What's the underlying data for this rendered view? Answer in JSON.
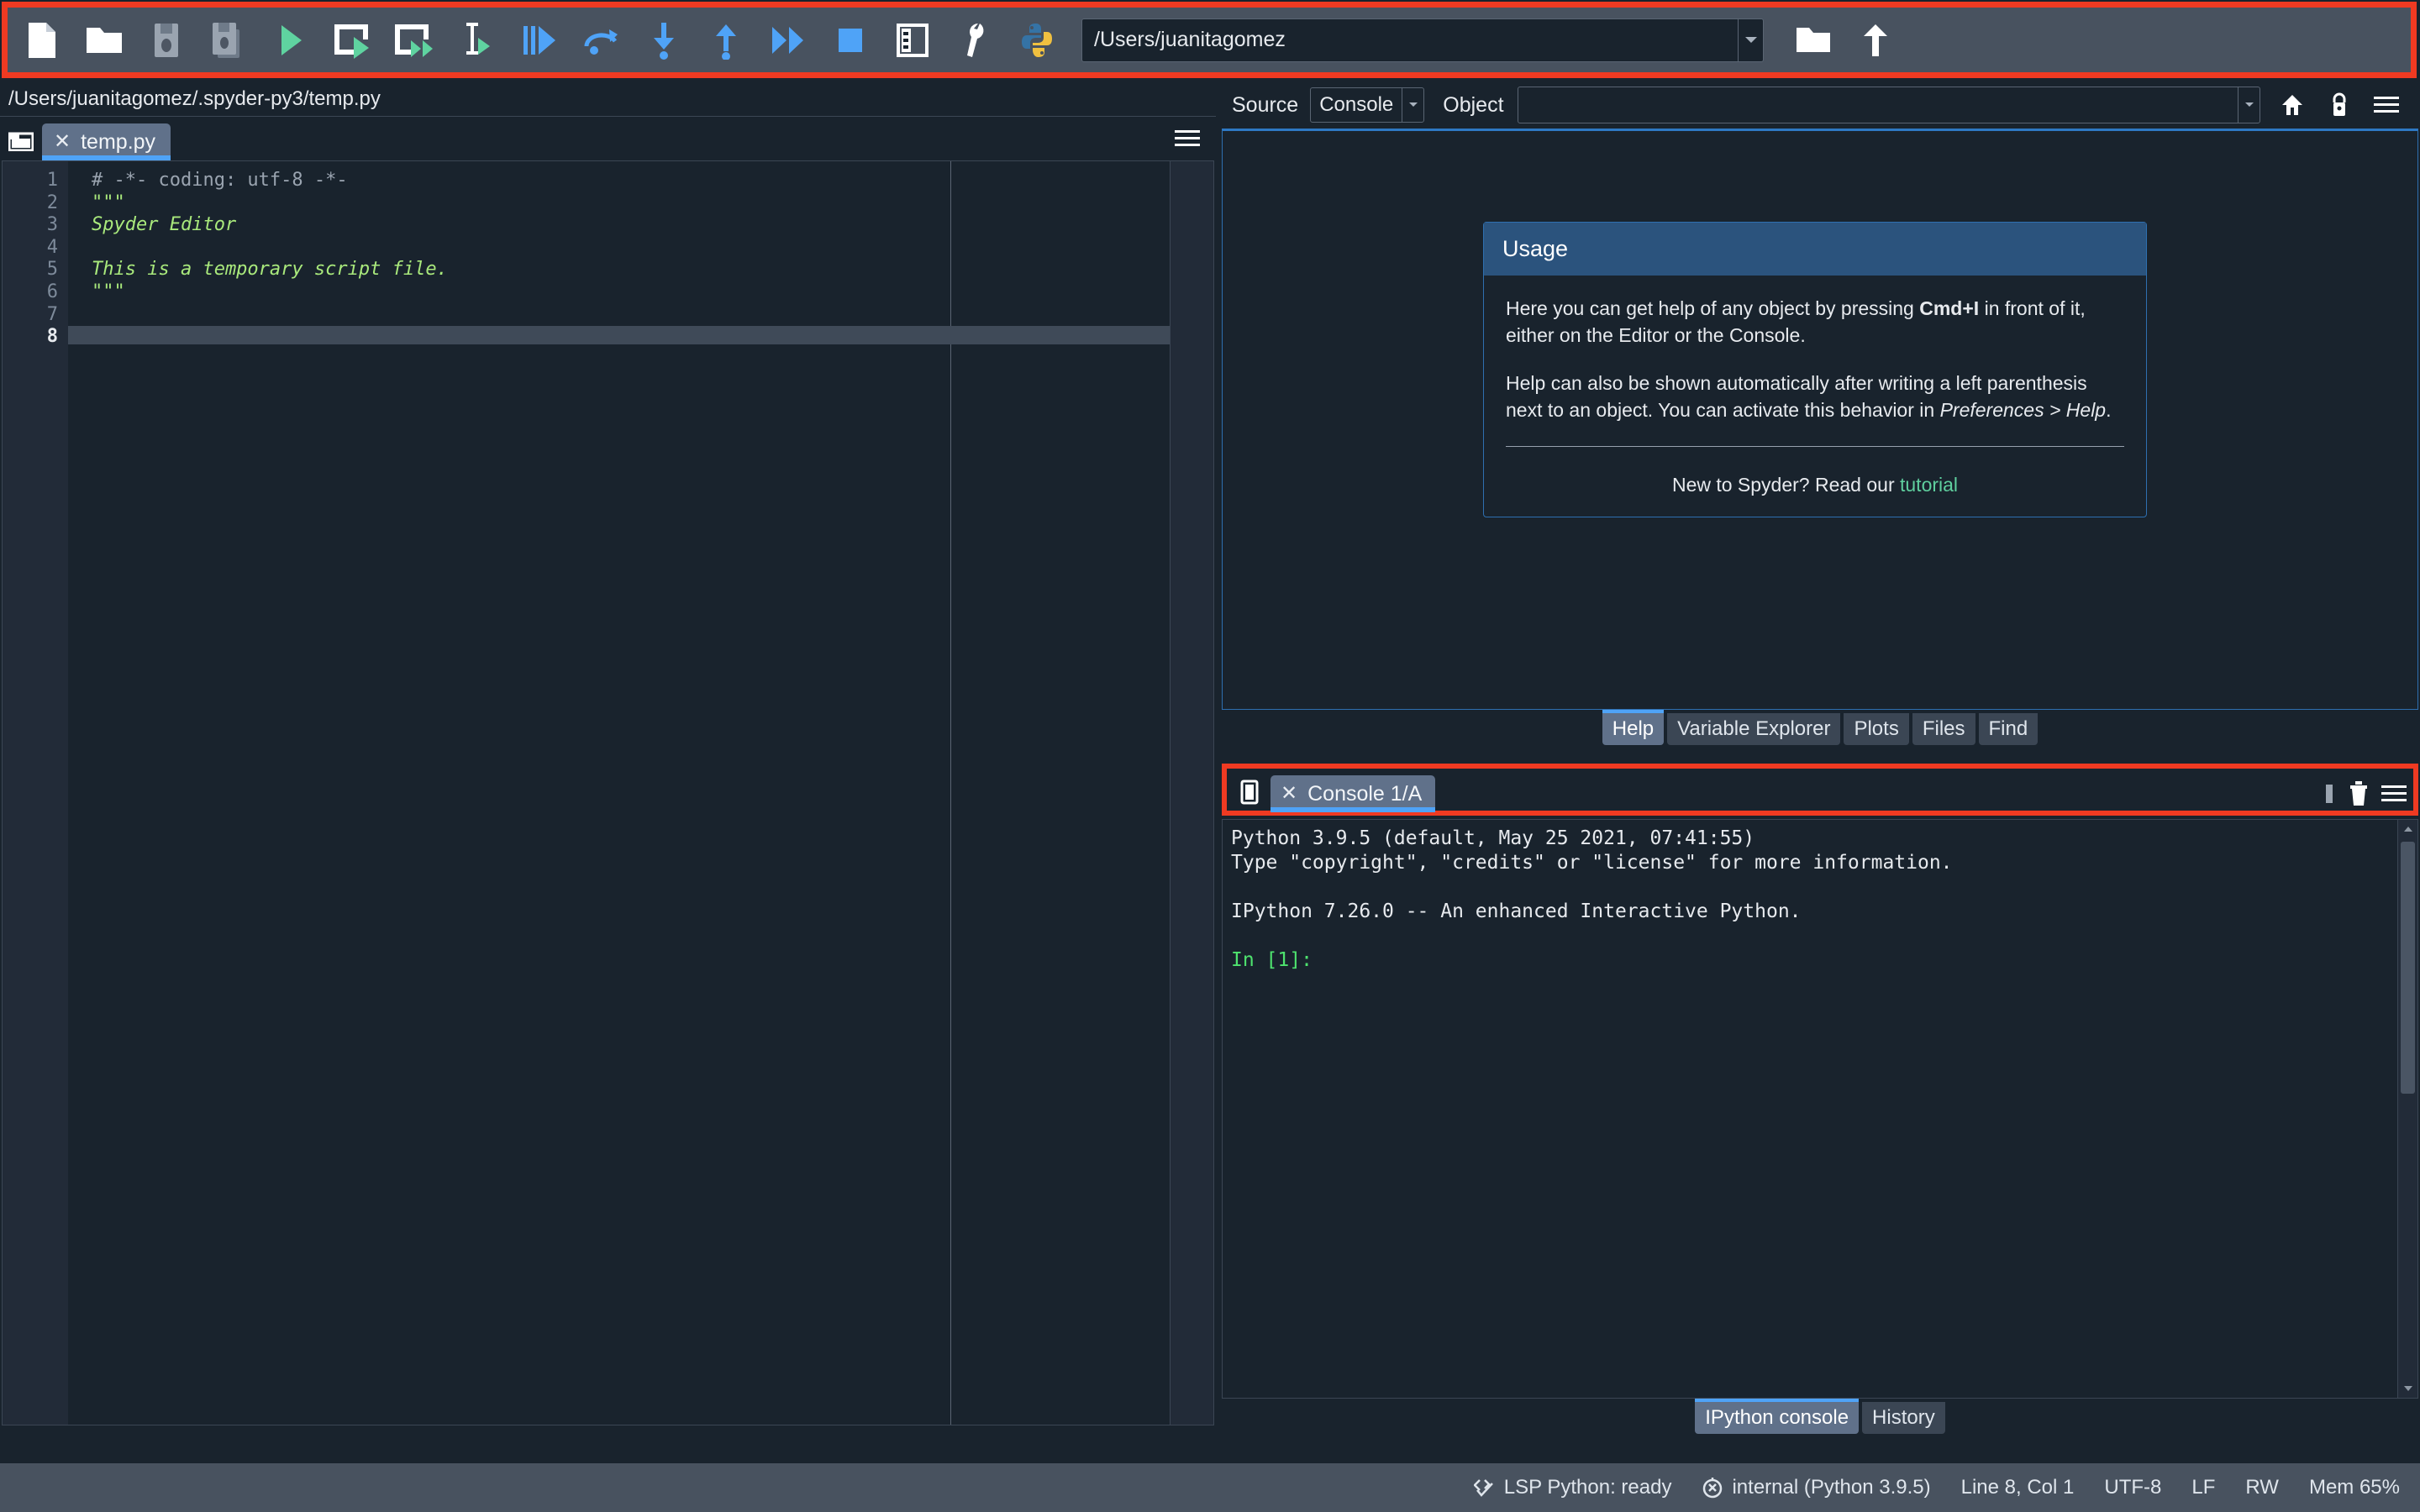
{
  "app": {
    "name": "Spyder"
  },
  "toolbar": {
    "buttons": [
      {
        "name": "new-file-button",
        "icon": "new-file-icon",
        "tooltip": "New file"
      },
      {
        "name": "open-file-button",
        "icon": "open-folder-icon",
        "tooltip": "Open file"
      },
      {
        "name": "save-file-button",
        "icon": "save-icon",
        "tooltip": "Save file"
      },
      {
        "name": "save-all-button",
        "icon": "save-all-icon",
        "tooltip": "Save all"
      },
      {
        "name": "run-file-button",
        "icon": "run-play-icon",
        "tooltip": "Run file"
      },
      {
        "name": "run-cell-button",
        "icon": "run-cell-icon",
        "tooltip": "Run current cell"
      },
      {
        "name": "run-cell-advance-button",
        "icon": "run-cell-advance-icon",
        "tooltip": "Run current cell and go to the next one"
      },
      {
        "name": "run-selection-button",
        "icon": "run-selection-icon",
        "tooltip": "Run selection or current line"
      },
      {
        "name": "debug-file-button",
        "icon": "debug-icon",
        "tooltip": "Debug file"
      },
      {
        "name": "debug-step-over-button",
        "icon": "step-over-icon",
        "tooltip": "Run current line"
      },
      {
        "name": "debug-step-into-button",
        "icon": "step-into-icon",
        "tooltip": "Step into function"
      },
      {
        "name": "debug-step-return-button",
        "icon": "step-return-icon",
        "tooltip": "Run until function returns"
      },
      {
        "name": "debug-continue-button",
        "icon": "continue-icon",
        "tooltip": "Continue execution"
      },
      {
        "name": "debug-stop-button",
        "icon": "stop-square-icon",
        "tooltip": "Stop debugging"
      },
      {
        "name": "maximize-pane-button",
        "icon": "maximize-pane-icon",
        "tooltip": "Maximize current pane"
      },
      {
        "name": "preferences-button",
        "icon": "wrench-icon",
        "tooltip": "Preferences"
      },
      {
        "name": "pythonpath-manager-button",
        "icon": "python-logo-icon",
        "tooltip": "PYTHONPATH manager"
      }
    ],
    "path_value": "/Users/juanitagomez",
    "path_placeholder": "",
    "browse_dir_button": "open-folder-icon",
    "parent_dir_button": "up-arrow-icon"
  },
  "editor": {
    "file_path": "/Users/juanitagomez/.spyder-py3/temp.py",
    "browse_icon": "browse-tabs-icon",
    "options_icon": "hamburger-icon",
    "tabs": [
      {
        "label": "temp.py",
        "active": true,
        "close_icon": "close-icon"
      }
    ],
    "line_numbers": [
      "1",
      "2",
      "3",
      "4",
      "5",
      "6",
      "7",
      "8"
    ],
    "current_line_index": 7,
    "code_lines": [
      {
        "text": "# -*- coding: utf-8 -*-",
        "style": "comment"
      },
      {
        "text": "\"\"\"",
        "style": "quote"
      },
      {
        "text": "Spyder Editor",
        "style": "string"
      },
      {
        "text": "",
        "style": "plain"
      },
      {
        "text": "This is a temporary script file.",
        "style": "string"
      },
      {
        "text": "\"\"\"",
        "style": "quote"
      },
      {
        "text": "",
        "style": "plain"
      },
      {
        "text": "",
        "style": "plain"
      }
    ]
  },
  "help": {
    "source_label": "Source",
    "source_value": "Console",
    "object_label": "Object",
    "object_value": "",
    "object_placeholder": "",
    "home_icon": "home-icon",
    "lock_icon": "lock-icon",
    "options_icon": "hamburger-icon",
    "usage": {
      "title": "Usage",
      "paragraph_1_pre": "Here you can get help of any object by pressing ",
      "paragraph_1_kbd": "Cmd+I",
      "paragraph_1_post": " in front of it, either on the Editor or the Console.",
      "paragraph_2_pre": "Help can also be shown automatically after writing a left parenthesis next to an object. You can activate this behavior in ",
      "paragraph_2_em": "Preferences > Help",
      "paragraph_2_post": ".",
      "footer_pre": "New to Spyder? Read our ",
      "footer_link": "tutorial"
    },
    "tabs": [
      {
        "label": "Help",
        "active": true
      },
      {
        "label": "Variable Explorer",
        "active": false
      },
      {
        "label": "Plots",
        "active": false
      },
      {
        "label": "Files",
        "active": false
      },
      {
        "label": "Find",
        "active": false
      }
    ]
  },
  "console": {
    "browse_icon": "browse-tabs-icon",
    "tabs": [
      {
        "label": "Console 1/A",
        "active": true,
        "close_icon": "close-icon"
      }
    ],
    "interrupt_icon": "interrupt-kernel-icon",
    "remove_icon": "trash-icon",
    "options_icon": "hamburger-icon",
    "output_lines": [
      {
        "text": "Python 3.9.5 (default, May 25 2021, 07:41:55)",
        "style": "plain"
      },
      {
        "text": "Type \"copyright\", \"credits\" or \"license\" for more information.",
        "style": "plain"
      },
      {
        "text": "",
        "style": "blank"
      },
      {
        "text": "IPython 7.26.0 -- An enhanced Interactive Python.",
        "style": "plain"
      },
      {
        "text": "",
        "style": "blank"
      },
      {
        "text": "In [1]:",
        "style": "green"
      }
    ],
    "tabs_bottom": [
      {
        "label": "IPython console",
        "active": true
      },
      {
        "label": "History",
        "active": false
      }
    ]
  },
  "statusbar": {
    "lsp_icon": "code-check-icon",
    "lsp_status": "LSP Python: ready",
    "interpreter_icon": "python-env-icon",
    "interpreter": "internal (Python 3.9.5)",
    "cursor_position": "Line 8, Col 1",
    "encoding": "UTF-8",
    "eol": "LF",
    "permissions": "RW",
    "memory": "Mem 65%"
  },
  "colors": {
    "highlight_red": "#ef3a22",
    "toolbar_bg": "#48525f",
    "panel_bg": "#19232d",
    "accent_blue": "#4fa3f7",
    "tab_active": "#60718a",
    "string_green": "#a9e97c",
    "prompt_green": "#4ee36e"
  }
}
